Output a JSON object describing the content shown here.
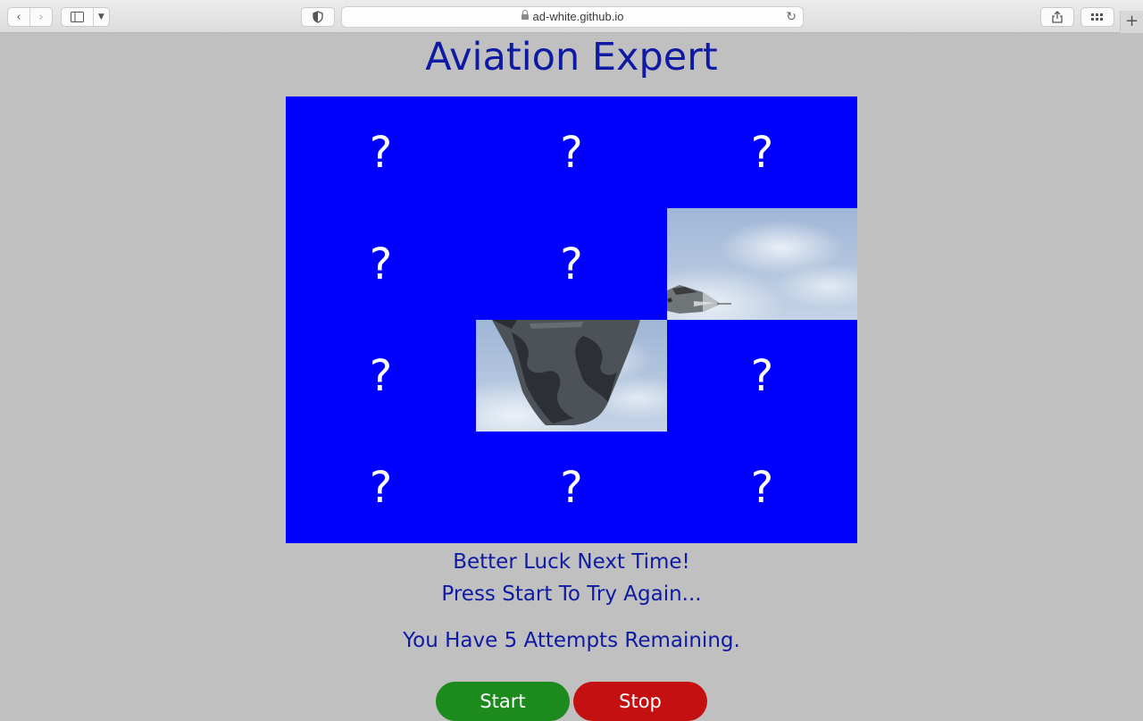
{
  "browser": {
    "url": "ad-white.github.io"
  },
  "page": {
    "title": "Aviation Expert",
    "tiles": [
      {
        "state": "hidden",
        "label": "?"
      },
      {
        "state": "hidden",
        "label": "?"
      },
      {
        "state": "hidden",
        "label": "?"
      },
      {
        "state": "hidden",
        "label": "?"
      },
      {
        "state": "hidden",
        "label": "?"
      },
      {
        "state": "revealed",
        "label": ""
      },
      {
        "state": "hidden",
        "label": "?"
      },
      {
        "state": "revealed",
        "label": ""
      },
      {
        "state": "hidden",
        "label": "?"
      },
      {
        "state": "hidden",
        "label": "?"
      },
      {
        "state": "hidden",
        "label": "?"
      },
      {
        "state": "hidden",
        "label": "?"
      }
    ],
    "message_line1": "Better Luck Next Time!",
    "message_line2": "Press Start To Try Again...",
    "attempts_text": "You Have 5 Attempts Remaining.",
    "start_label": "Start",
    "stop_label": "Stop"
  },
  "colors": {
    "board": "#0000ff",
    "title_text": "#0f1aa3",
    "start_button": "#1d8a1d",
    "stop_button": "#c41010",
    "background": "#c0c0c0"
  }
}
